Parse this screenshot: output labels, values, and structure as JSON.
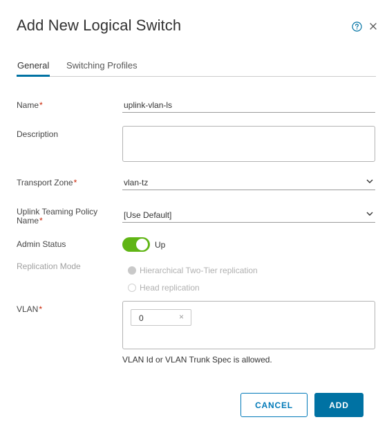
{
  "dialog": {
    "title": "Add New Logical Switch",
    "help_icon": "help-circle-icon",
    "close_icon": "close-icon"
  },
  "tabs": [
    {
      "label": "General",
      "active": true
    },
    {
      "label": "Switching Profiles",
      "active": false
    }
  ],
  "form": {
    "name": {
      "label": "Name",
      "required_mark": "*",
      "value": "uplink-vlan-ls"
    },
    "description": {
      "label": "Description",
      "value": ""
    },
    "transport_zone": {
      "label": "Transport Zone",
      "required_mark": "*",
      "value": "vlan-tz"
    },
    "uplink_teaming": {
      "label_line1": "Uplink Teaming Policy",
      "label_line2": "Name",
      "required_mark": "*",
      "value": "[Use Default]"
    },
    "admin_status": {
      "label": "Admin Status",
      "value": "Up",
      "enabled": true
    },
    "replication_mode": {
      "label": "Replication Mode",
      "options": [
        {
          "label": "Hierarchical Two-Tier replication",
          "selected": true
        },
        {
          "label": "Head replication",
          "selected": false
        }
      ]
    },
    "vlan": {
      "label": "VLAN",
      "required_mark": "*",
      "chip_value": "0",
      "chip_remove": "×",
      "hint": "VLAN Id or VLAN Trunk Spec is allowed."
    }
  },
  "buttons": {
    "cancel": "CANCEL",
    "add": "ADD"
  },
  "colors": {
    "accent": "#0072a3",
    "toggle_on": "#60b515",
    "required": "#c92100"
  }
}
